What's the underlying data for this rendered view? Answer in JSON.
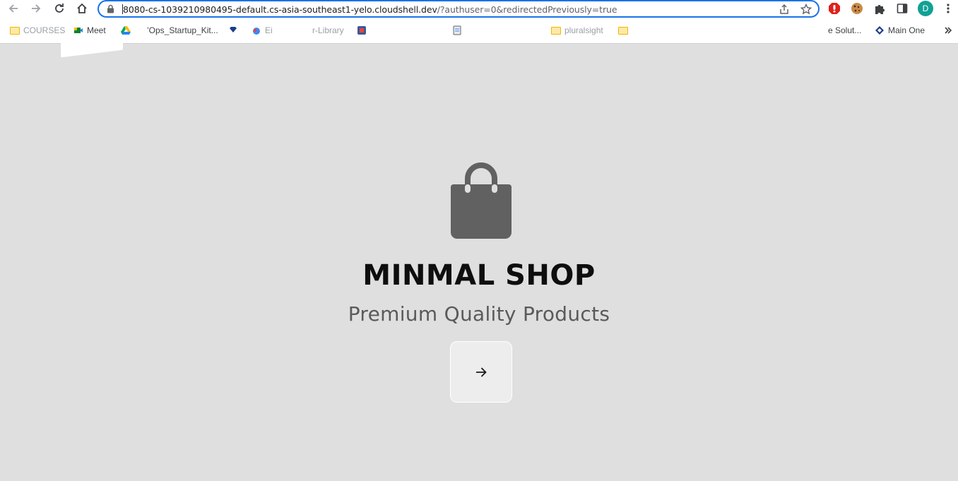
{
  "browser": {
    "url_main": "8080-cs-1039210980495-default.cs-asia-southeast1-yelo.cloudshell.dev",
    "url_rest": "/?authuser=0&redirectedPreviously=true",
    "profile_initial": "D",
    "bookmarks": [
      {
        "label": "COURSES",
        "icon": "folder-icon"
      },
      {
        "label": "Meet",
        "icon": "meet-icon"
      },
      {
        "label": "’Ops_Startup_Kit...",
        "icon": "drive-icon"
      },
      {
        "label": "",
        "icon": "bookmark-icon"
      },
      {
        "label": "Ei",
        "icon": "cloud-icon"
      },
      {
        "label": "r-Library",
        "icon": ""
      },
      {
        "label": "",
        "icon": "app-icon"
      },
      {
        "label": "",
        "icon": "doc-icon"
      },
      {
        "label": "pluralsight",
        "icon": "folder-icon"
      },
      {
        "label": "",
        "icon": "folder-icon"
      },
      {
        "label": "e Solut...",
        "icon": ""
      },
      {
        "label": "Main One",
        "icon": "main-one-icon"
      }
    ]
  },
  "shop": {
    "icon": "shopping-bag-icon",
    "title": "MINMAL SHOP",
    "tagline": "Premium Quality Products",
    "enter_icon": "arrow-right-icon"
  },
  "colors": {
    "page_background": "#dfdfdf",
    "icon": "#616161",
    "title": "#0e0e0e",
    "tagline": "#5a5a5a",
    "button": "#ededed",
    "omnibox_focus": "#1a73e8"
  }
}
